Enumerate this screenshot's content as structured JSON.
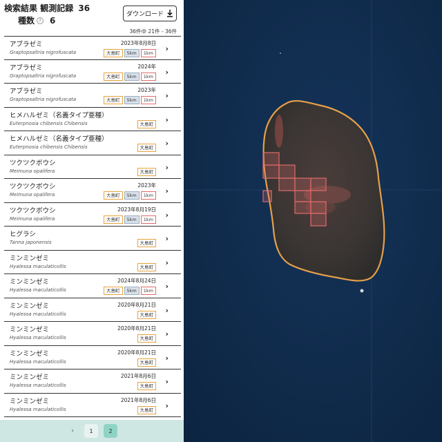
{
  "header": {
    "title": "検索結果",
    "obs_label": "観測記録",
    "obs_count": "36",
    "species_label": "種数",
    "help_icon": "?",
    "species_count": "6",
    "download_label": "ダウンロード",
    "range_text": "36件中 21件 - 36件"
  },
  "records": [
    {
      "jp": "アブラゼミ",
      "sci": "Graptopsaltria nigrofuscata",
      "date": "2023年8月8日",
      "tags": [
        "大島町",
        "5km",
        "1km"
      ]
    },
    {
      "jp": "アブラゼミ",
      "sci": "Graptopsaltria nigrofuscata",
      "date": "2024年",
      "tags": [
        "大島町",
        "5km",
        "1km"
      ]
    },
    {
      "jp": "アブラゼミ",
      "sci": "Graptopsaltria nigrofuscata",
      "date": "2023年",
      "tags": [
        "大島町",
        "5km",
        "1km"
      ]
    },
    {
      "jp": "ヒメハルゼミ（名義タイプ亜種）",
      "sci": "Euterpnosia chibensis Chibensis",
      "date": "",
      "tags": [
        "大島町"
      ]
    },
    {
      "jp": "ヒメハルゼミ（名義タイプ亜種）",
      "sci": "Euterpnosia chibensis Chibensis",
      "date": "",
      "tags": [
        "大島町"
      ]
    },
    {
      "jp": "ツクツクボウシ",
      "sci": "Meimuna opalifera",
      "date": "",
      "tags": [
        "大島町"
      ]
    },
    {
      "jp": "ツクツクボウシ",
      "sci": "Meimuna opalifera",
      "date": "2023年",
      "tags": [
        "大島町",
        "5km",
        "1km"
      ]
    },
    {
      "jp": "ツクツクボウシ",
      "sci": "Meimuna opalifera",
      "date": "2023年8月19日",
      "tags": [
        "大島町",
        "5km",
        "1km"
      ]
    },
    {
      "jp": "ヒグラシ",
      "sci": "Tanna japonensis",
      "date": "",
      "tags": [
        "大島町"
      ]
    },
    {
      "jp": "ミンミンゼミ",
      "sci": "Hyalessa maculaticollis",
      "date": "",
      "tags": [
        "大島町"
      ]
    },
    {
      "jp": "ミンミンゼミ",
      "sci": "Hyalessa maculaticollis",
      "date": "2024年8月24日",
      "tags": [
        "大島町",
        "5km",
        "1km"
      ]
    },
    {
      "jp": "ミンミンゼミ",
      "sci": "Hyalessa maculaticollis",
      "date": "2020年8月21日",
      "tags": [
        "大島町"
      ]
    },
    {
      "jp": "ミンミンゼミ",
      "sci": "Hyalessa maculaticollis",
      "date": "2020年8月21日",
      "tags": [
        "大島町"
      ]
    },
    {
      "jp": "ミンミンゼミ",
      "sci": "Hyalessa maculaticollis",
      "date": "2020年8月21日",
      "tags": [
        "大島町"
      ]
    },
    {
      "jp": "ミンミンゼミ",
      "sci": "Hyalessa maculaticollis",
      "date": "2021年8月6日",
      "tags": [
        "大島町"
      ]
    },
    {
      "jp": "ミンミンゼミ",
      "sci": "Hyalessa maculaticollis",
      "date": "2021年8月6日",
      "tags": [
        "大島町"
      ]
    }
  ],
  "pagination": {
    "prev_label": "‹",
    "pages": [
      "1",
      "2"
    ],
    "current": "2"
  },
  "icons": {
    "download": "download-icon",
    "row_chevron": "chevron-right-icon",
    "help": "help-circle-icon"
  },
  "colors": {
    "ocean": "#0f2a4a",
    "island": "#3d3634",
    "coast": "#e6a04a",
    "grid_cell": "#e06a6a",
    "tag_town": "#e8a23a",
    "tag_5km": "#d9e1ea",
    "tag_1km": "#e06a6a",
    "pager_bg": "#cfe7e3",
    "page_active": "#8fd3c6"
  }
}
